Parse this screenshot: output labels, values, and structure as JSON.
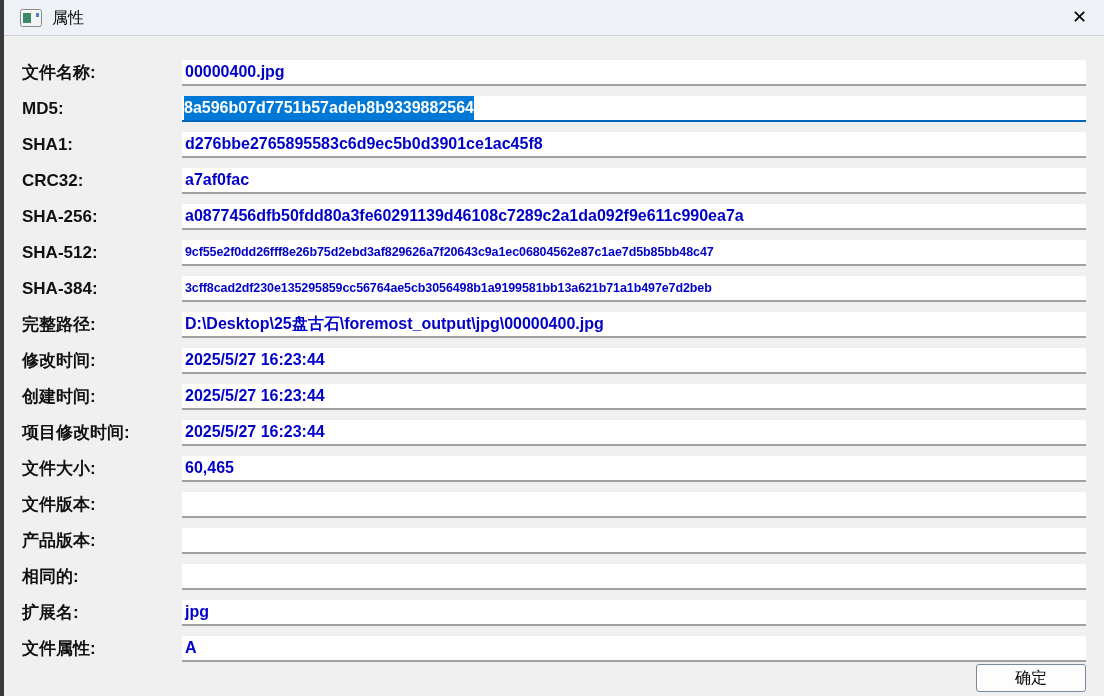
{
  "window": {
    "title": "属性",
    "close": "✕"
  },
  "fields": [
    {
      "label": "文件名称:",
      "value": "00000400.jpg",
      "selected": false
    },
    {
      "label": "MD5:",
      "value": "8a596b07d7751b57adeb8b9339882564",
      "selected": true
    },
    {
      "label": "SHA1:",
      "value": "d276bbe2765895583c6d9ec5b0d3901ce1ac45f8",
      "selected": false
    },
    {
      "label": "CRC32:",
      "value": "a7af0fac",
      "selected": false
    },
    {
      "label": "SHA-256:",
      "value": "a0877456dfb50fdd80a3fe60291139d46108c7289c2a1da092f9e611c990ea7a",
      "selected": false
    },
    {
      "label": "SHA-512:",
      "value": "9cf55e2f0dd26fff8e26b75d2ebd3af829626a7f20643c9a1ec06804562e87c1ae7d5b85bb48c47",
      "selected": false
    },
    {
      "label": "SHA-384:",
      "value": "3cff8cad2df230e135295859cc56764ae5cb3056498b1a9199581bb13a621b71a1b497e7d2beb",
      "selected": false
    },
    {
      "label": "完整路径:",
      "value": "D:\\Desktop\\25盘古石\\foremost_output\\jpg\\00000400.jpg",
      "selected": false
    },
    {
      "label": "修改时间:",
      "value": "2025/5/27 16:23:44",
      "selected": false
    },
    {
      "label": "创建时间:",
      "value": "2025/5/27 16:23:44",
      "selected": false
    },
    {
      "label": "项目修改时间:",
      "value": "2025/5/27 16:23:44",
      "selected": false
    },
    {
      "label": "文件大小:",
      "value": "60,465",
      "selected": false
    },
    {
      "label": "文件版本:",
      "selected": false
    },
    {
      "label": "产品版本:",
      "selected": false
    },
    {
      "label": "相同的:",
      "selected": false
    },
    {
      "label": "扩展名:",
      "value": "jpg",
      "selected": false
    },
    {
      "label": "文件属性:",
      "value": "A",
      "selected": false
    }
  ],
  "ok_button": "确定"
}
